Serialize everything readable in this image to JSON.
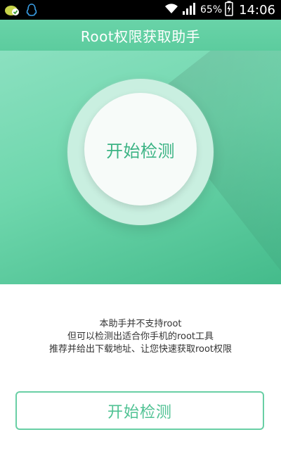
{
  "status_bar": {
    "battery_percent": "65%",
    "time": "14:06"
  },
  "header": {
    "title": "Root权限获取助手"
  },
  "hero": {
    "check_label": "开始检测"
  },
  "description": {
    "line1": "本助手并不支持root",
    "line2": "但可以检测出适合你手机的root工具",
    "line3": "推荐并给出下载地址、让您快速获取root权限"
  },
  "bottom_button": {
    "label": "开始检测"
  },
  "colors": {
    "accent": "#4fc293",
    "hero_top": "#8be0c0",
    "hero_bottom": "#44bb8b",
    "status_bar": "#000000"
  },
  "icons": {
    "notification_1": "cloud-check-icon",
    "notification_2": "qq-penguin-icon",
    "wifi": "wifi-icon",
    "signal": "signal-bars-icon",
    "battery": "battery-charging-icon"
  }
}
